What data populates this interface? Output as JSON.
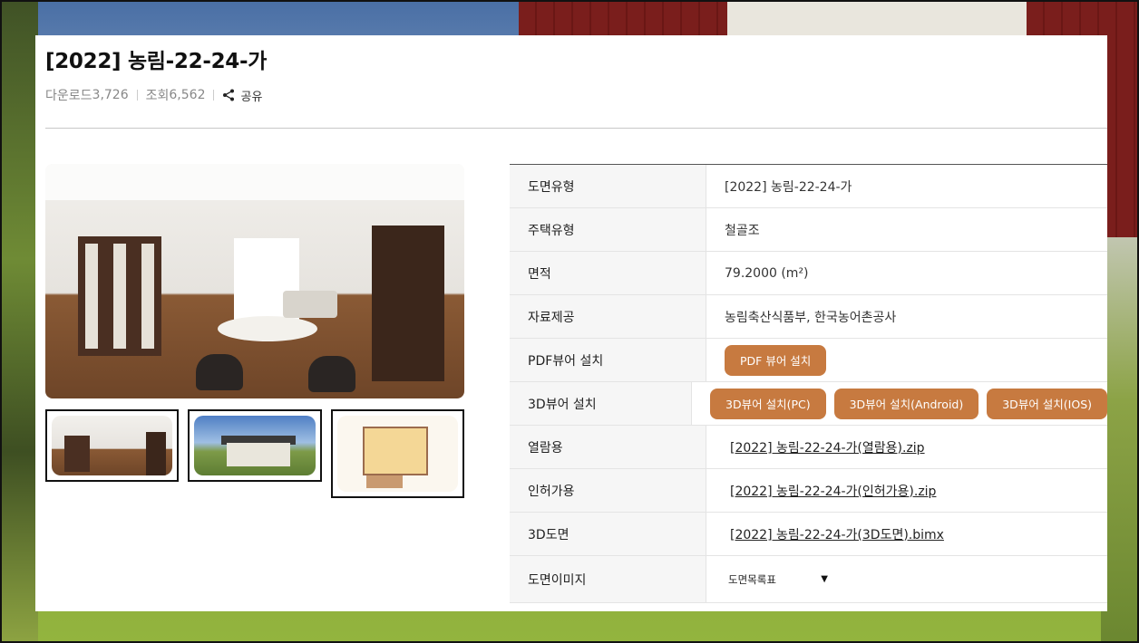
{
  "page": {
    "title": "[2022] 농림-22-24-가",
    "download_label": "다운로드",
    "download_count": "3,726",
    "view_label": "조회",
    "view_count": "6,562",
    "share_label": "공유"
  },
  "details": [
    {
      "label": "도면유형",
      "value": "[2022] 농림-22-24-가"
    },
    {
      "label": "주택유형",
      "value": "철골조"
    },
    {
      "label": "면적",
      "value": "79.2000 (m²)"
    },
    {
      "label": "자료제공",
      "value": "농림축산식품부, 한국농어촌공사"
    }
  ],
  "pdf_viewer": {
    "label": "PDF뷰어 설치",
    "button": "PDF 뷰어 설치"
  },
  "viewer_3d": {
    "label": "3D뷰어 설치",
    "buttons": [
      "3D뷰어 설치(PC)",
      "3D뷰어 설치(Android)",
      "3D뷰어 설치(IOS)"
    ]
  },
  "files": [
    {
      "label": "열람용",
      "file": "[2022] 농림-22-24-가(열람용).zip"
    },
    {
      "label": "인허가용",
      "file": "[2022] 농림-22-24-가(인허가용).zip"
    },
    {
      "label": "3D도면",
      "file": "[2022] 농림-22-24-가(3D도면).bimx"
    }
  ],
  "drawing_images": {
    "label": "도면이미지",
    "selected": "도면목록표"
  },
  "colors": {
    "accent": "#c77a40",
    "header_bg": "#f6f6f6"
  },
  "icons": {
    "share": "share-icon",
    "select": "chevron-down-icon"
  }
}
